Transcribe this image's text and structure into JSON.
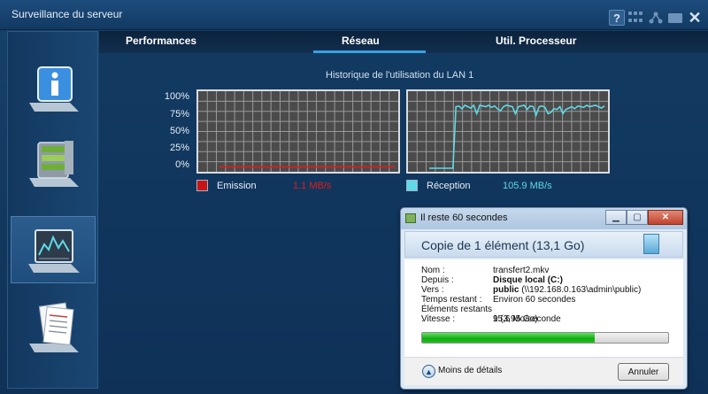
{
  "window": {
    "title": "Surveillance du serveur"
  },
  "tabs": [
    {
      "label": "Performances"
    },
    {
      "label": "Réseau",
      "active": true
    },
    {
      "label": "Util. Processeur"
    }
  ],
  "sidebar": {
    "items": [
      {
        "icon": "info-icon"
      },
      {
        "icon": "storage-icon"
      },
      {
        "icon": "monitor-graph-icon",
        "active": true
      },
      {
        "icon": "log-document-icon"
      }
    ]
  },
  "chart_data": {
    "type": "line",
    "title": "Historique de l'utilisation du LAN 1",
    "y_ticks": [
      "100%",
      "75%",
      "50%",
      "25%",
      "0%"
    ],
    "ylim": [
      0,
      100
    ],
    "grid": true,
    "series": [
      {
        "name": "Emission",
        "color": "#e01b1b",
        "value_text": "1.1 MB/s",
        "values": [
          2,
          2,
          2,
          2,
          2,
          2,
          2,
          2,
          2,
          2,
          2,
          2,
          2,
          2,
          2,
          2,
          2,
          2,
          2,
          2,
          2,
          2,
          2,
          2,
          2,
          2,
          2,
          2,
          2,
          2,
          2,
          2,
          2,
          2,
          2,
          2,
          2,
          2,
          2,
          2,
          2,
          2,
          2,
          2,
          2,
          2,
          2,
          2,
          2,
          2,
          2,
          2,
          2,
          2,
          2,
          2,
          2,
          2,
          2,
          2
        ]
      },
      {
        "name": "Réception",
        "color": "#5fd9e6",
        "value_text": "105.9 MB/s",
        "values": [
          0,
          0,
          0,
          0,
          0,
          0,
          0,
          0,
          0,
          88,
          89,
          85,
          90,
          88,
          86,
          90,
          78,
          90,
          89,
          88,
          90,
          87,
          89,
          85,
          82,
          88,
          90,
          89,
          88,
          78,
          88,
          89,
          90,
          84,
          89,
          88,
          76,
          88,
          89,
          87,
          78,
          80,
          85,
          84,
          88,
          78,
          84,
          86,
          88,
          85,
          89,
          88,
          87,
          90,
          88,
          89,
          90,
          88,
          86,
          89
        ]
      }
    ]
  },
  "dialog": {
    "title": "Il reste 60 secondes",
    "heading": "Copie de 1 élément (13,1 Go)",
    "rows": {
      "name": {
        "label": "Nom :",
        "value": "transfert2.mkv"
      },
      "from": {
        "label": "Depuis :",
        "value": "Disque local (C:)"
      },
      "to": {
        "label": "Vers :",
        "value_bold": "public",
        "value_rest": " (\\\\192.168.0.163\\admin\\public)"
      },
      "time": {
        "label": "Temps restant :",
        "value": "Environ 60 secondes"
      },
      "items": {
        "label": "Éléments restants :",
        "value": "1 (3,95 Go)"
      },
      "speed": {
        "label": "Vitesse :",
        "value": "95,6 Mo/seconde"
      }
    },
    "progress": 0.7,
    "less_details": "Moins de détails",
    "cancel_label": "Annuler"
  }
}
